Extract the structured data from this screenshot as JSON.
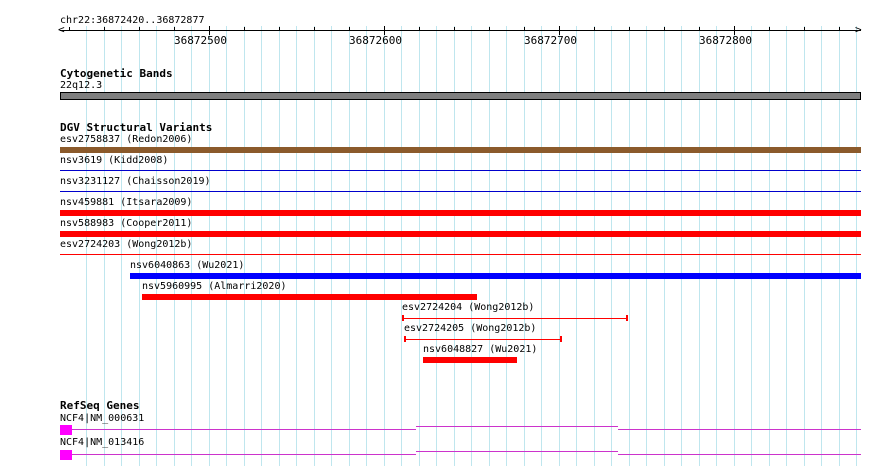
{
  "ruler": {
    "location": "chr22:36872420..36872877",
    "ticks": [
      "36872500",
      "36872600",
      "36872700",
      "36872800"
    ]
  },
  "tracks": {
    "cytobands": {
      "title": "Cytogenetic Bands",
      "band_label": "22q12.3",
      "band_color": "#7f7f7f"
    },
    "dgv": {
      "title": "DGV Structural Variants",
      "features": [
        {
          "label": "esv2758837 (Redon2006)",
          "color": "#8b5a2b"
        },
        {
          "label": "nsv3619 (Kidd2008)",
          "color": "#0000cc"
        },
        {
          "label": "nsv3231127 (Chaisson2019)",
          "color": "#0000cc"
        },
        {
          "label": "nsv459881 (Itsara2009)",
          "color": "#ff0000"
        },
        {
          "label": "nsv588983 (Cooper2011)",
          "color": "#ff0000"
        },
        {
          "label": "esv2724203 (Wong2012b)",
          "color": "#ff0000"
        },
        {
          "label": "nsv6040863 (Wu2021)",
          "color": "#0000ff"
        },
        {
          "label": "nsv5960995 (Almarri2020)",
          "color": "#ff0000"
        },
        {
          "label": "esv2724204 (Wong2012b)",
          "color": "#ff0000"
        },
        {
          "label": "esv2724205 (Wong2012b)",
          "color": "#ff0000"
        },
        {
          "label": "nsv6048827 (Wu2021)",
          "color": "#ff0000"
        }
      ]
    },
    "refseq": {
      "title": "RefSeq Genes",
      "genes": [
        {
          "label": "NCF4|NM_000631",
          "color": "#cc33cc"
        },
        {
          "label": "NCF4|NM_013416",
          "color": "#cc33cc"
        }
      ]
    }
  }
}
